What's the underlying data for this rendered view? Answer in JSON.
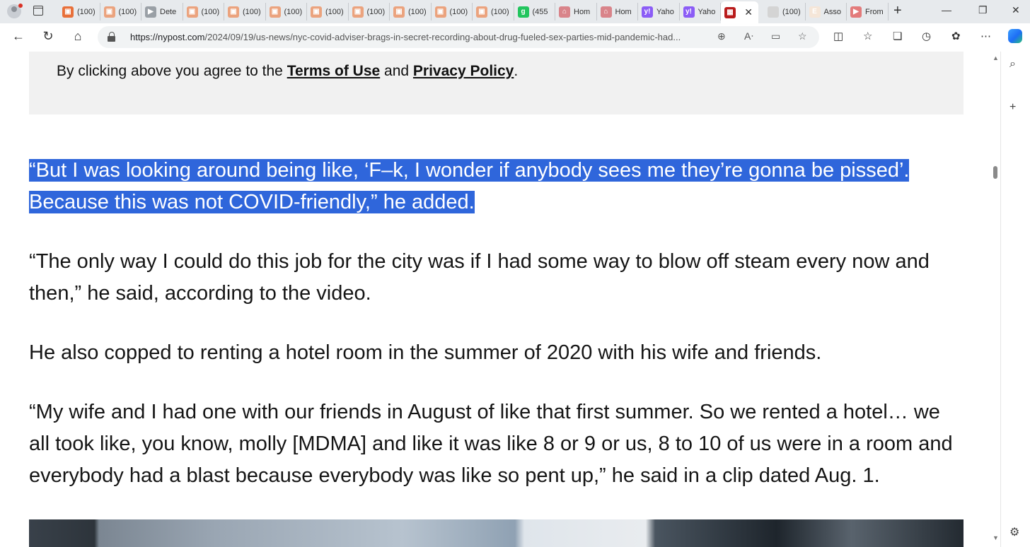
{
  "browser": {
    "tabs": [
      {
        "label": "(100)",
        "color": "#e8703a",
        "glyph": "▣"
      },
      {
        "label": "(100)",
        "color": "#eba37e",
        "glyph": "▣"
      },
      {
        "label": "Dete",
        "color": "#9aa0a6",
        "glyph": "▶"
      },
      {
        "label": "(100)",
        "color": "#eba37e",
        "glyph": "▣"
      },
      {
        "label": "(100)",
        "color": "#eba37e",
        "glyph": "▣"
      },
      {
        "label": "(100)",
        "color": "#eba37e",
        "glyph": "▣"
      },
      {
        "label": "(100)",
        "color": "#eba37e",
        "glyph": "▣"
      },
      {
        "label": "(100)",
        "color": "#eba37e",
        "glyph": "▣"
      },
      {
        "label": "(100)",
        "color": "#eba37e",
        "glyph": "▣"
      },
      {
        "label": "(100)",
        "color": "#eba37e",
        "glyph": "▣"
      },
      {
        "label": "(100)",
        "color": "#eba37e",
        "glyph": "▣"
      },
      {
        "label": "(455",
        "color": "#22c55e",
        "glyph": "g"
      },
      {
        "label": "Hom",
        "color": "#d9848a",
        "glyph": "⌂"
      },
      {
        "label": "Hom",
        "color": "#d9848a",
        "glyph": "⌂"
      },
      {
        "label": "Yaho",
        "color": "#8b5cf6",
        "glyph": "y!"
      },
      {
        "label": "Yaho",
        "color": "#8b5cf6",
        "glyph": "y!"
      },
      {
        "label": "",
        "color": "#b91c1c",
        "glyph": "▦",
        "active": true
      },
      {
        "label": "(100)",
        "color": "#d4d4d4",
        "glyph": ""
      },
      {
        "label": "Asso",
        "color": "#f5e6d8",
        "glyph": "E"
      },
      {
        "label": "From",
        "color": "#e37b7b",
        "glyph": "▶"
      }
    ],
    "url_host": "https://nypost.com",
    "url_path": "/2024/09/19/us-news/nyc-covid-adviser-brags-in-secret-recording-about-drug-fueled-sex-parties-mid-pandemic-had..."
  },
  "article": {
    "consent": {
      "prefix": "By clicking above you agree to the ",
      "terms_link": "Terms of Use",
      "middle": " and ",
      "privacy_link": "Privacy Policy",
      "suffix": "."
    },
    "highlighted_quote": "“But I was looking around being like, ‘F–k, I wonder if anybody sees me they’re gonna be pissed’. Because this was not COVID-friendly,” he added.",
    "paragraph_1": "“The only way I could do this job for the city was if I had some way to blow off steam every now and then,” he said, according to the video.",
    "paragraph_2": "He also copped to renting a hotel room in the summer of 2020 with his wife and friends.",
    "paragraph_3": "“My wife and I had one with our friends in August of like that first summer. So we rented a hotel… we all took like, you know, molly [MDMA] and like it was like 8 or 9 or us, 8 to 10 of us were in a room and everybody had a blast because everybody was like so pent up,” he said in a clip dated Aug. 1."
  },
  "colors": {
    "selection": "#2f66db",
    "consent_bg": "#f1f1f1"
  }
}
